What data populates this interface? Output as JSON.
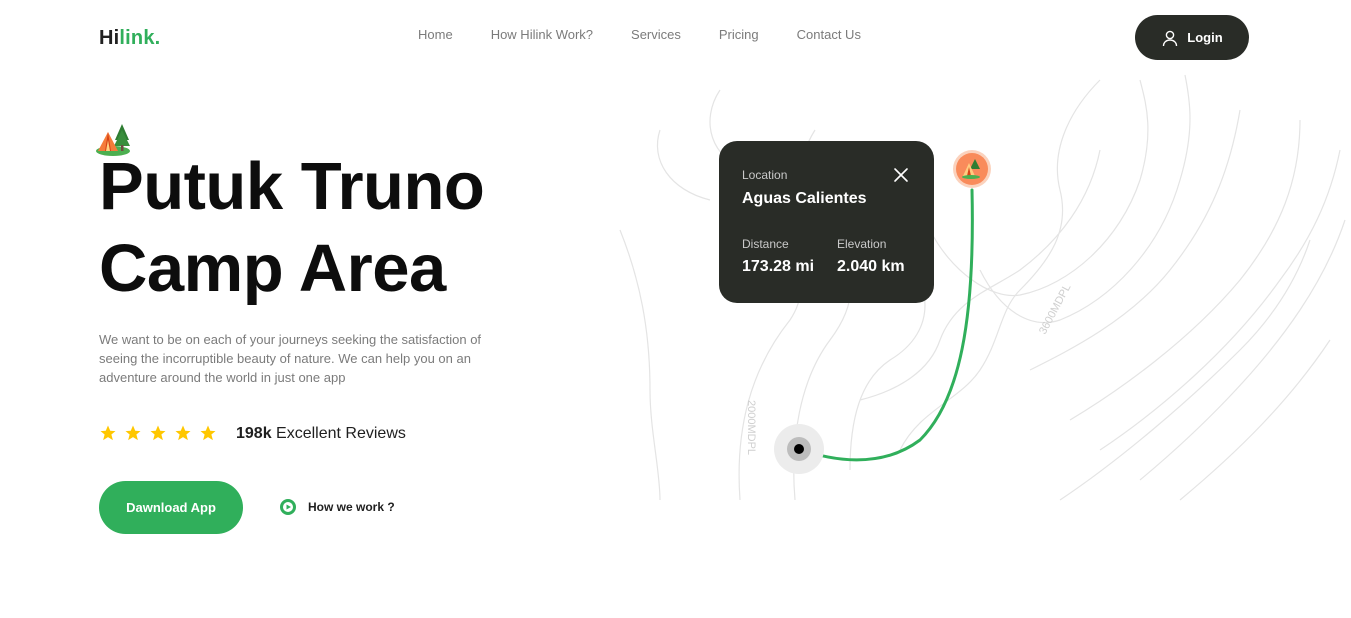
{
  "brand": {
    "part1": "Hi",
    "part2": "link."
  },
  "nav": {
    "items": [
      "Home",
      "How Hilink Work?",
      "Services",
      "Pricing",
      "Contact Us"
    ],
    "login_label": "Login"
  },
  "hero": {
    "title_line1": "Putuk Truno",
    "title_line2": "Camp Area",
    "description": "We want to be on each of your journeys seeking the satisfaction of seeing the incorruptible beauty of nature. We can help you on an adventure around the world in just one app",
    "rating_stars": 5,
    "reviews_count": "198k",
    "reviews_text": "Excellent Reviews",
    "download_label": "Dawnload App",
    "how_label": "How we work ?"
  },
  "map": {
    "contour_label_1": "3600MDPL",
    "contour_label_2": "2000MDPL",
    "route_color": "#30af5b",
    "pin_color": "#f98b5b"
  },
  "location_card": {
    "location_label": "Location",
    "location_value": "Aguas Calientes",
    "distance_label": "Distance",
    "distance_value": "173.28 mi",
    "elevation_label": "Elevation",
    "elevation_value": "2.040 km"
  },
  "colors": {
    "accent": "#30af5b",
    "dark": "#292c27",
    "star": "#ffc700"
  },
  "icons": {
    "user": "user-icon",
    "close": "close-icon",
    "play": "play-icon",
    "star": "star-icon",
    "camp": "camp-icon"
  }
}
